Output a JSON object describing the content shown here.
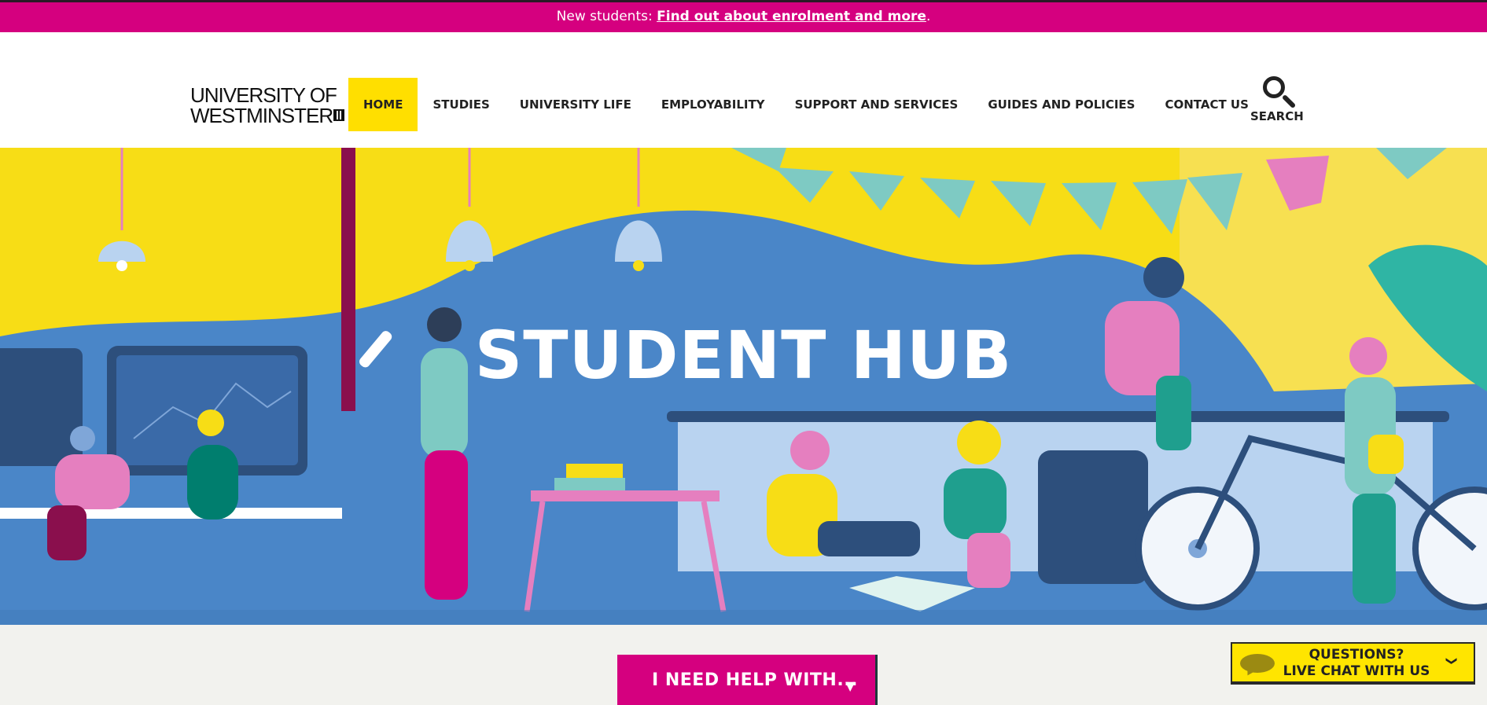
{
  "notice": {
    "prefix": "New students:",
    "link": "Find out about enrolment and more",
    "suffix": "."
  },
  "logo": {
    "line1": "UNIVERSITY OF",
    "line2": "WESTMINSTER"
  },
  "nav": {
    "items": [
      {
        "label": "HOME",
        "active": true
      },
      {
        "label": "STUDIES"
      },
      {
        "label": "UNIVERSITY LIFE"
      },
      {
        "label": "EMPLOYABILITY"
      },
      {
        "label": "SUPPORT AND SERVICES"
      },
      {
        "label": "GUIDES AND POLICIES"
      },
      {
        "label": "CONTACT US"
      }
    ]
  },
  "search": {
    "label": "SEARCH",
    "icon": "search-icon"
  },
  "hero": {
    "title": "STUDENT HUB"
  },
  "help": {
    "label": "I NEED HELP WITH...",
    "icon": "chevron-down-icon"
  },
  "chat": {
    "line1": "QUESTIONS?",
    "line2": "LIVE CHAT WITH US",
    "icon": "chat-bubble-icon"
  },
  "colors": {
    "brand_pink": "#d5007f",
    "brand_yellow": "#ffdf00",
    "hero_blue": "#4a86c8"
  }
}
